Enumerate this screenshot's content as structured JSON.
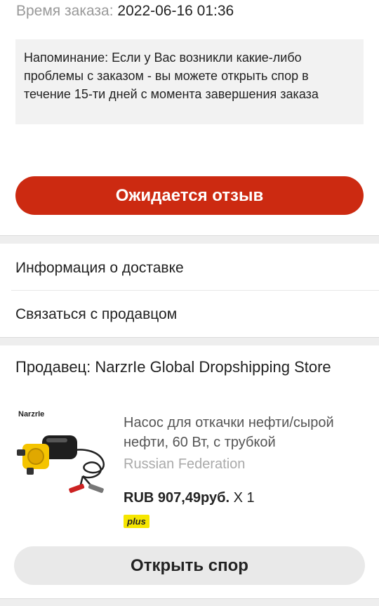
{
  "order": {
    "time_label": "Время заказа:",
    "time_value": "2022-06-16 01:36"
  },
  "reminder": {
    "text": "Напоминание: Если у Вас возникли какие-либо проблемы с заказом - вы можете открыть спор в течение 15-ти дней с момента завершения заказа"
  },
  "actions": {
    "review_label": "Ожидается отзыв",
    "dispute_label": "Открыть спор"
  },
  "menu": {
    "delivery_info": "Информация о доставке",
    "contact_seller": "Связаться с продавцом"
  },
  "seller": {
    "label": "Продавец: NarzrIe Global Dropshipping Store"
  },
  "product": {
    "brand_tag": "NarzrIe",
    "title": "Насос для откачки нефти/сырой нефти, 60 Вт, с трубкой",
    "region": "Russian Federation",
    "price": "RUB 907,49руб.",
    "quantity": "X 1",
    "badge": "plus"
  },
  "colors": {
    "primary": "#cc2a11",
    "badge": "#f6e600"
  }
}
